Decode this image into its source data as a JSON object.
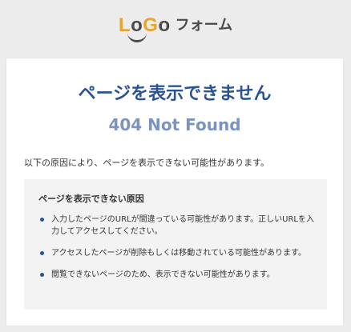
{
  "logo": {
    "mark": [
      "L",
      "o",
      "G",
      "o"
    ],
    "text": "フォーム"
  },
  "error": {
    "title": "ページを表示できません",
    "subtitle": "404 Not Found",
    "intro": "以下の原因により、ページを表示できない可能性があります。"
  },
  "reasons": {
    "heading": "ページを表示できない原因",
    "items": [
      "入力したページのURLが間違っている可能性があります。正しいURLを入力してアクセスしてください。",
      "アクセスしたページが削除もしくは移動されている可能性があります。",
      "閲覧できないページのため、表示できない可能性があります。"
    ]
  },
  "colors": {
    "accent": "#2a5394",
    "subtitle": "#7b93bf",
    "logo_yellow": "#e7a52d",
    "logo_dark": "#4a4a4a"
  }
}
